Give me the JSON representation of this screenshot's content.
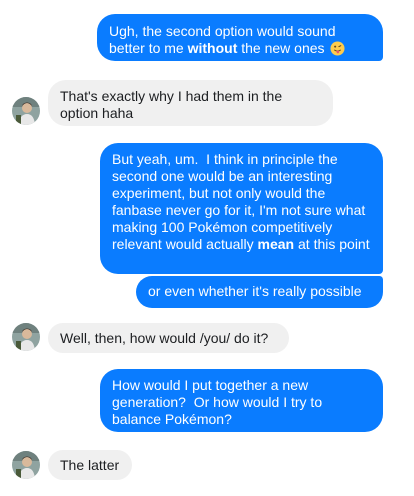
{
  "conversation": {
    "messages": [
      {
        "from": "me",
        "parts": [
          {
            "text": "Ugh, the second option would sound better to me "
          },
          {
            "text": "without",
            "bold": true
          },
          {
            "text": " the new ones "
          }
        ],
        "emoji": "tongue-out-emoji"
      },
      {
        "from": "them",
        "text": "That's exactly why I had them in the option haha"
      },
      {
        "from": "me",
        "parts": [
          {
            "text": "But yeah, um.  I think in principle the second one would be an interesting experiment, but not only would the fanbase never go for it, I'm not sure what making 100 Pokémon competitively relevant would actually "
          },
          {
            "text": "mean",
            "bold": true
          },
          {
            "text": " at this point"
          }
        ]
      },
      {
        "from": "me",
        "text": "or even whether it's really possible"
      },
      {
        "from": "them",
        "text": "Well, then, how would /you/ do it?"
      },
      {
        "from": "me",
        "text": "How would I put together a new generation?  Or how would I try to balance Pokémon?"
      },
      {
        "from": "them",
        "text": "The latter"
      }
    ]
  },
  "colors": {
    "outgoing_bubble": "#0a7cff",
    "incoming_bubble": "#f0f0f0",
    "outgoing_text": "#ffffff",
    "incoming_text": "#1c1e21"
  }
}
